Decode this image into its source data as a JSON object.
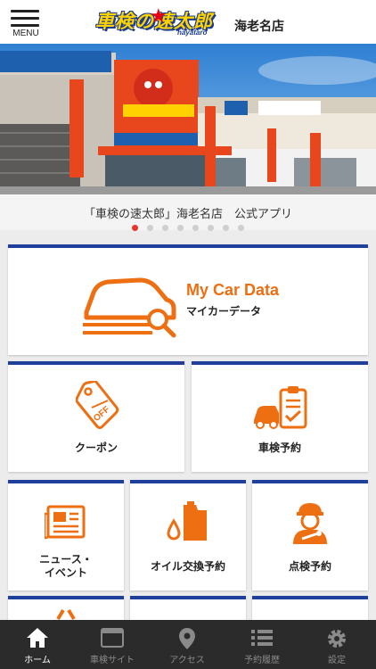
{
  "header": {
    "menu_label": "MENU",
    "logo_text": "車検の速太郎",
    "logo_sub": "hayataro",
    "store_name": "海老名店"
  },
  "hero": {
    "caption": "「車検の速太郎」海老名店　公式アプリ",
    "slide_count": 8,
    "active_slide": 1
  },
  "tiles": {
    "mycar": {
      "title": "My Car Data",
      "subtitle": "マイカーデータ"
    },
    "coupon": {
      "label": "クーポン"
    },
    "shaken_reserve": {
      "label": "車検予約"
    },
    "news": {
      "label_line1": "ニュース・",
      "label_line2": "イベント"
    },
    "oil": {
      "label": "オイル交換予約"
    },
    "inspection": {
      "label": "点検予約"
    }
  },
  "tabbar": {
    "items": [
      {
        "label": "ホーム",
        "icon": "home-icon",
        "active": true
      },
      {
        "label": "車検サイト",
        "icon": "browser-icon",
        "active": false
      },
      {
        "label": "アクセス",
        "icon": "map-pin-icon",
        "active": false
      },
      {
        "label": "予約履歴",
        "icon": "list-icon",
        "active": false
      },
      {
        "label": "設定",
        "icon": "gear-icon",
        "active": false
      }
    ]
  },
  "colors": {
    "accent_orange": "#ee6e12",
    "card_border_blue": "#1e3f9a",
    "dot_active": "#e6372c",
    "tabbar_bg": "#2b2b2b"
  }
}
